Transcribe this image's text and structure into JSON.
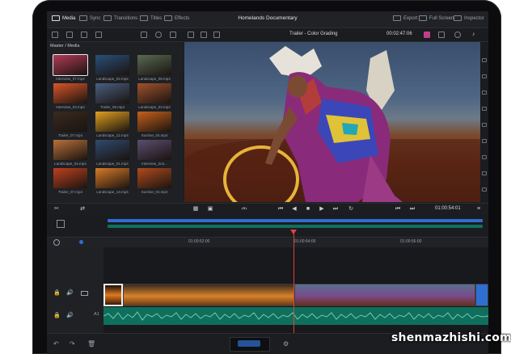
{
  "topbar": {
    "tabs": [
      {
        "label": "Media",
        "icon": "media-icon",
        "active": true
      },
      {
        "label": "Sync",
        "icon": "sync-icon"
      },
      {
        "label": "Transitions",
        "icon": "transitions-icon"
      },
      {
        "label": "Titles",
        "icon": "titles-icon"
      },
      {
        "label": "Effects",
        "icon": "effects-icon"
      }
    ],
    "title": "Homelands Documentary",
    "export_label": "Export",
    "fullscreen_label": "Full Screen",
    "inspector_label": "Inspector"
  },
  "viewer": {
    "title": "Trailer - Color Grading",
    "source_timecode": "00:02:47:06",
    "program_timecode": "01:00:54:01"
  },
  "media_pool": {
    "label": "Master / Media",
    "clips": [
      {
        "name": "Interview_07.mp4",
        "color": "#b23a56"
      },
      {
        "name": "Landscape_02.mp4",
        "color": "#2a4f7a"
      },
      {
        "name": "Landscape_08.mp4",
        "color": "#5a6a52"
      },
      {
        "name": "Interview_03.mp4",
        "color": "#d9562a"
      },
      {
        "name": "Trailer_06.mp4",
        "color": "#4a5f82"
      },
      {
        "name": "Landscape_03.mp4",
        "color": "#a0522d"
      },
      {
        "name": "Trailer_07.mp4",
        "color": "#3a2a20"
      },
      {
        "name": "Landscape_12.mp4",
        "color": "#e0a020"
      },
      {
        "name": "Sunrise_04.mp4",
        "color": "#c6601c"
      },
      {
        "name": "Landscape_04.mp4",
        "color": "#b8703a"
      },
      {
        "name": "Landscape_01.mp4",
        "color": "#304a6e"
      },
      {
        "name": "Interview_2o4...",
        "color": "#5b4e70"
      },
      {
        "name": "Trailer_07.mp4",
        "color": "#c0401f"
      },
      {
        "name": "Landscape_13.mp4",
        "color": "#d87a28"
      },
      {
        "name": "Sunrise_04.mp4",
        "color": "#b24a1e"
      }
    ]
  },
  "ruler": {
    "labels": [
      "01:00:52:00",
      "01:00:54:00",
      "01:00:56:00"
    ]
  },
  "tracks": {
    "video_label": "",
    "audio_label": "A1"
  },
  "colors": {
    "accent": "#e3413a",
    "audio": "#0f6f5c",
    "selection": "#2f6fd1"
  }
}
